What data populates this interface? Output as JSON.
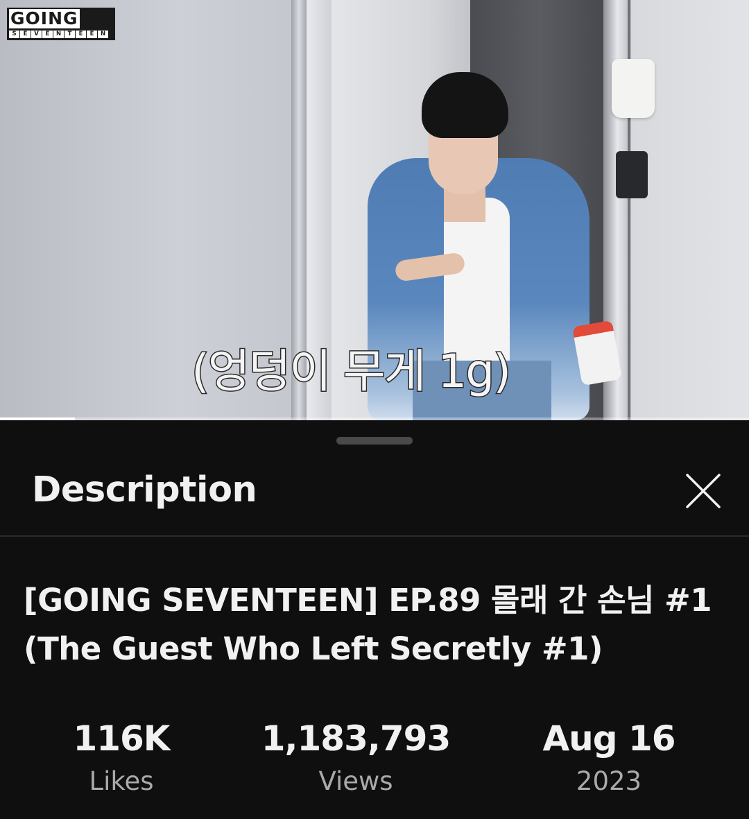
{
  "video": {
    "logo": {
      "top": "GOING",
      "bottom": [
        "S",
        "E",
        "V",
        "E",
        "N",
        "T",
        "E",
        "E",
        "N"
      ]
    },
    "caption": "(엉덩이 무게 1g)",
    "progress_fraction": 0.1
  },
  "sheet": {
    "title": "Description",
    "close_icon": "close-icon",
    "video_title": "[GOING SEVENTEEN] EP.89 몰래 간 손님 #1 (The Guest Who Left Secretly #1)",
    "stats": [
      {
        "value": "116K",
        "label": "Likes"
      },
      {
        "value": "1,183,793",
        "label": "Views"
      },
      {
        "value": "Aug 16",
        "label": "2023"
      }
    ]
  },
  "colors": {
    "background": "#0f0f0f",
    "text_primary": "#f1f1f1",
    "text_secondary": "#aaaaaa"
  }
}
